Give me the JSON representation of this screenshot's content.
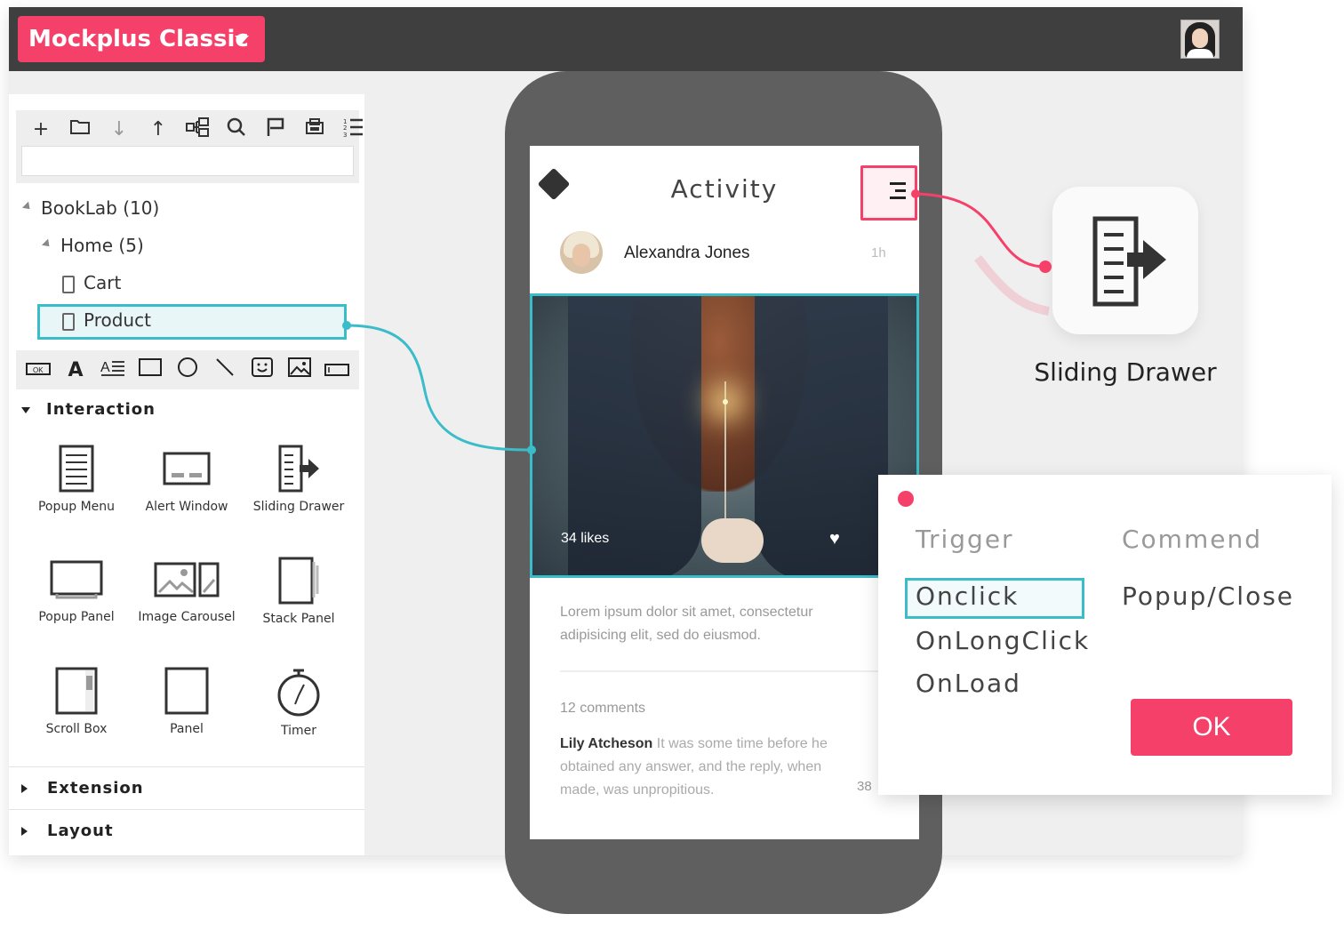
{
  "app": {
    "brand": "Mockplus Classic",
    "user_avatar": "user-avatar-icon"
  },
  "toolbar": {
    "icons": [
      "plus-icon",
      "folder-icon",
      "move-down-icon",
      "move-up-icon",
      "hierarchy-icon",
      "search-icon",
      "flag-icon",
      "export-icon",
      "list-icon"
    ],
    "search_value": ""
  },
  "tree": {
    "root": "BookLab (10)",
    "folder": "Home (5)",
    "pages": [
      "Cart",
      "Product"
    ],
    "selected": "Product"
  },
  "components_toolbar": {
    "icons": [
      "button-icon",
      "text-icon",
      "paragraph-icon",
      "rectangle-icon",
      "circle-icon",
      "line-icon",
      "emoji-icon",
      "image-icon",
      "input-icon"
    ]
  },
  "sections": {
    "interaction": "Interaction",
    "extension": "Extension",
    "layout": "Layout"
  },
  "widgets": [
    "Popup Menu",
    "Alert Window",
    "Sliding Drawer",
    "Popup Panel",
    "Image Carousel",
    "Stack Panel",
    "Scroll Box",
    "Panel",
    "Timer"
  ],
  "phone": {
    "title": "Activity",
    "post_author": "Alexandra Jones",
    "post_time": "1h",
    "likes": "34 likes",
    "body": "Lorem ipsum dolor sit amet, consectetur adipisicing elit, sed do eiusmod.",
    "comments_count": "12 comments",
    "comment_author": "Lily Atcheson",
    "comment_text": " It was some time before he obtained any answer, and the reply, when made, was unpropitious.",
    "comment_time": "38"
  },
  "drawer": {
    "label": "Sliding Drawer"
  },
  "dialog": {
    "trigger_heading": "Trigger",
    "command_heading": "Commend",
    "triggers": [
      "Onclick",
      "OnLongClick",
      "OnLoad"
    ],
    "selected_trigger": "Onclick",
    "command": "Popup/Close",
    "ok": "OK"
  },
  "colors": {
    "accent": "#f5416a",
    "selection": "#3bbcc9",
    "topbar": "#3f3f3f"
  }
}
